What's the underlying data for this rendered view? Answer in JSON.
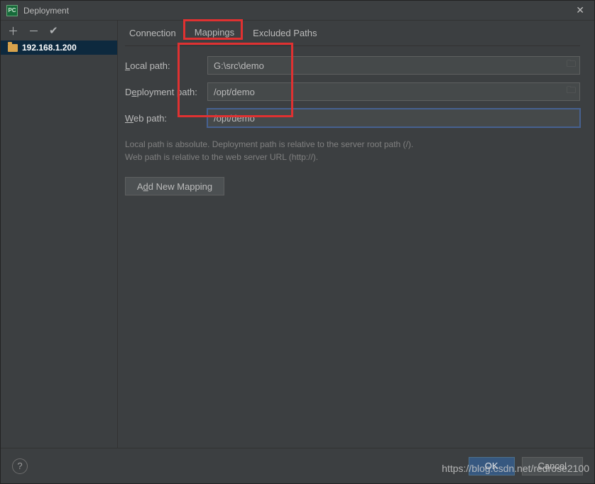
{
  "titlebar": {
    "title": "Deployment"
  },
  "sidebar": {
    "server": "192.168.1.200"
  },
  "tabs": {
    "connection": "Connection",
    "mappings": "Mappings",
    "excluded": "Excluded Paths"
  },
  "form": {
    "local_label_pre": "L",
    "local_label_post": "ocal path:",
    "local_value": "G:\\src\\demo",
    "deploy_label_pre": "D",
    "deploy_label_mid": "e",
    "deploy_label_post": "ployment path:",
    "deploy_value": "/opt/demo",
    "web_label_pre": "",
    "web_label_u": "W",
    "web_label_post": "eb path:",
    "web_value": "/opt/demo",
    "help1": "Local path is absolute. Deployment path is relative to the server root path (/).",
    "help2": "Web path is relative to the web server URL (http://).",
    "add_pre": "A",
    "add_u": "d",
    "add_post": "d New Mapping"
  },
  "footer": {
    "ok": "OK",
    "cancel": "Cancel"
  },
  "watermark": "https://blog.csdn.net/redrose2100"
}
